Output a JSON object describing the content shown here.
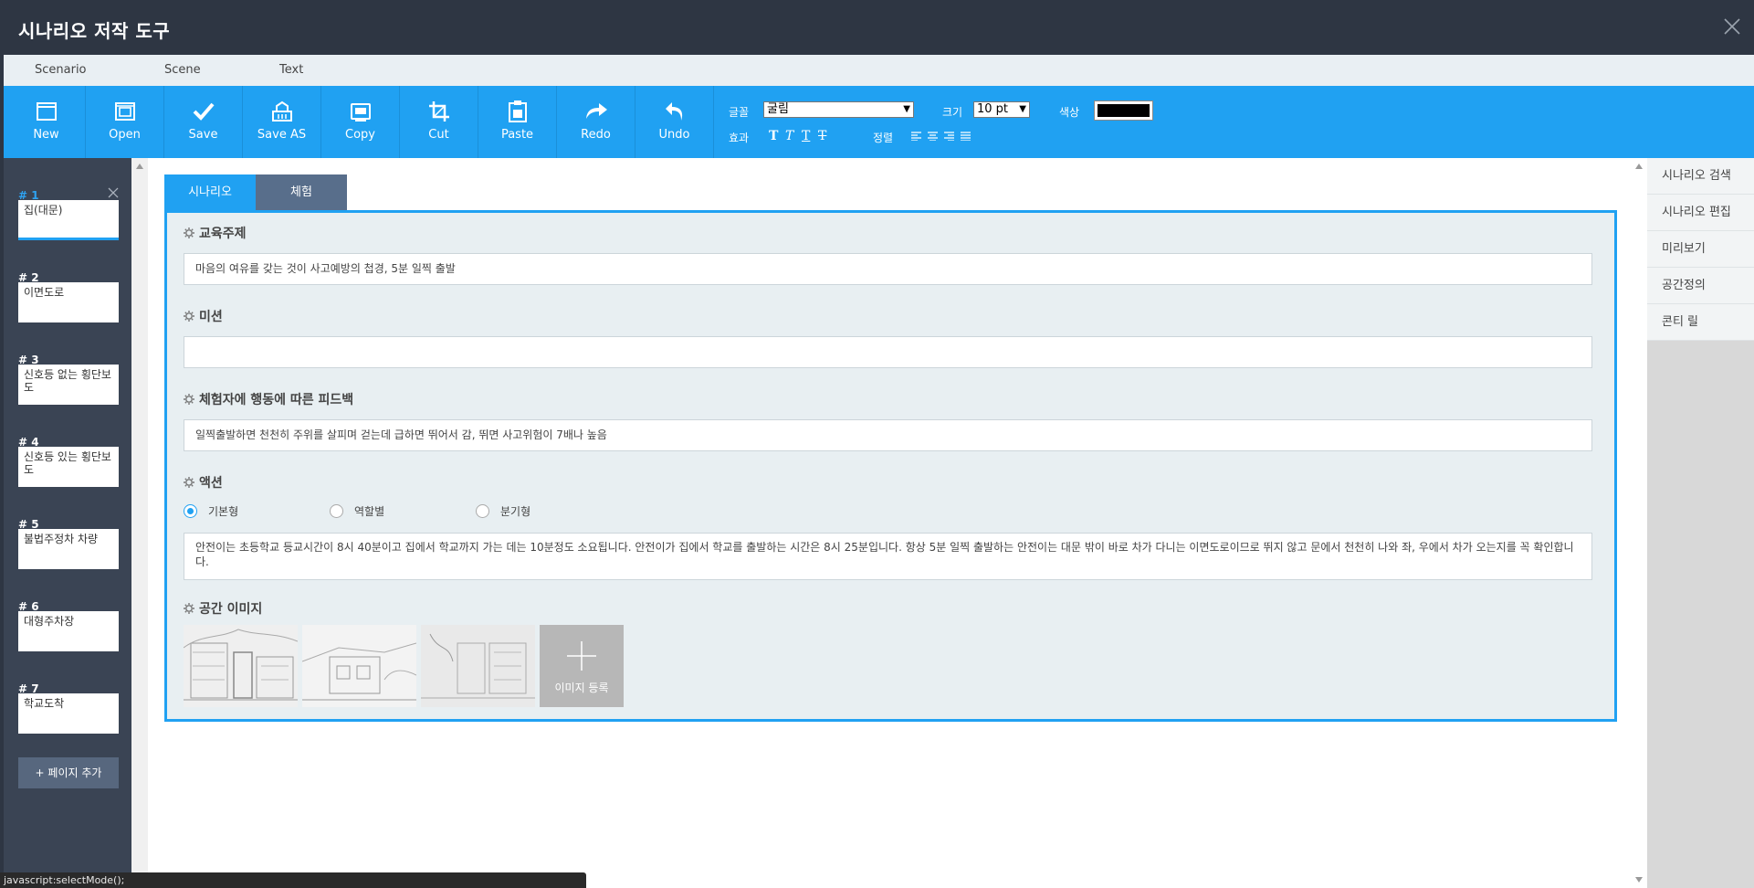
{
  "window": {
    "title": "시나리오 저작 도구"
  },
  "menu": [
    "Scenario",
    "Scene",
    "Text"
  ],
  "toolbar": {
    "buttons": [
      {
        "label": "New",
        "icon": "new-icon"
      },
      {
        "label": "Open",
        "icon": "open-icon"
      },
      {
        "label": "Save",
        "icon": "save-icon"
      },
      {
        "label": "Save AS",
        "icon": "save-as-icon"
      },
      {
        "label": "Copy",
        "icon": "copy-icon"
      },
      {
        "label": "Cut",
        "icon": "cut-icon"
      },
      {
        "label": "Paste",
        "icon": "paste-icon"
      },
      {
        "label": "Redo",
        "icon": "redo-icon"
      },
      {
        "label": "Undo",
        "icon": "undo-icon"
      }
    ],
    "format": {
      "font_label": "글꼴",
      "font_value": "굴림",
      "size_label": "크기",
      "size_value": "10 pt",
      "color_label": "색상",
      "color_value": "#000000",
      "effect_label": "효과",
      "effects": [
        "T",
        "T",
        "T",
        "T"
      ],
      "align_label": "정렬"
    }
  },
  "pages": [
    {
      "num": "# 1",
      "title": "집(대문)"
    },
    {
      "num": "# 2",
      "title": "이면도로"
    },
    {
      "num": "# 3",
      "title": "신호등 없는 횡단보도"
    },
    {
      "num": "# 4",
      "title": "신호등 있는 횡단보도"
    },
    {
      "num": "# 5",
      "title": "불법주정차 차량"
    },
    {
      "num": "# 6",
      "title": "대형주차장"
    },
    {
      "num": "# 7",
      "title": "학교도착"
    }
  ],
  "add_page_label": "+ 페이지 추가",
  "tabs": [
    "시나리오",
    "체험"
  ],
  "sections": {
    "topic": {
      "label": "교육주제",
      "value": "마음의 여유를 갖는 것이 사고예방의 첩경, 5분 일찍 출발"
    },
    "mission": {
      "label": "미션",
      "value": ""
    },
    "feedback": {
      "label": "체험자에 행동에 따른 피드백",
      "value": "일찍출발하면 천천히 주위를 살피며 걷는데 급하면 뛰어서 감, 뛰면 사고위험이 7배나 높음"
    },
    "action": {
      "label": "액션",
      "options": [
        "기본형",
        "역할별",
        "분기형"
      ],
      "selected": "기본형",
      "value": "안전이는 초등학교 등교시간이 8시 40분이고 집에서 학교까지 가는 데는 10분정도 소요됩니다. 안전이가 집에서 학교를 출발하는 시간은 8시 25분입니다. 항상 5분 일찍 출발하는 안전이는 대문 밖이 바로 차가 다니는 이면도로이므로 뛰지 않고 문에서 천천히 나와 좌, 우에서 차가 오는지를 꼭 확인합니다."
    },
    "images": {
      "label": "공간 이미지",
      "add_label": "이미지 등록"
    }
  },
  "right_menu": [
    "시나리오 검색",
    "시나리오 편집",
    "미리보기",
    "공간정의",
    "콘티 릴"
  ],
  "status": "javascript:selectMode();"
}
